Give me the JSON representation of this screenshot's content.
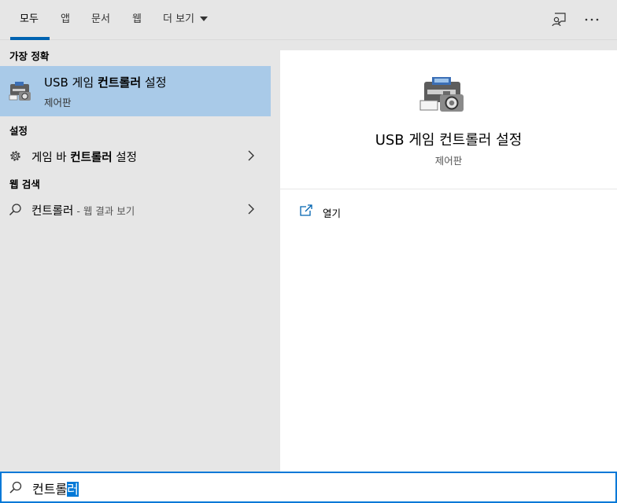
{
  "tabs": [
    {
      "label": "모두"
    },
    {
      "label": "앱"
    },
    {
      "label": "문서"
    },
    {
      "label": "웹"
    },
    {
      "label": "더 보기"
    }
  ],
  "top_icons": [
    "feedback-icon",
    "more-options-icon"
  ],
  "left": {
    "best_match_header": "가장 정확",
    "best_match": {
      "title_prefix": "USB 게임 ",
      "title_bold": "컨트롤러",
      "title_suffix": " 설정",
      "subtitle": "제어판",
      "icon": "control-panel-device-icon"
    },
    "settings_header": "설정",
    "settings_item": {
      "prefix": "게임 바 ",
      "bold": "컨트롤러",
      "suffix": " 설정",
      "icon": "gear-icon"
    },
    "web_header": "웹 검색",
    "web_item": {
      "bold": "컨트롤러",
      "hint": " - 웹 결과 보기",
      "icon": "search-icon"
    }
  },
  "right": {
    "title": "USB 게임 컨트롤러 설정",
    "subtitle": "제어판",
    "action_label": "열기"
  },
  "search": {
    "query_unselected": "컨트롤",
    "query_selected": "러"
  },
  "colors": {
    "accent": "#0078d7",
    "selection": "#a9cae8"
  }
}
